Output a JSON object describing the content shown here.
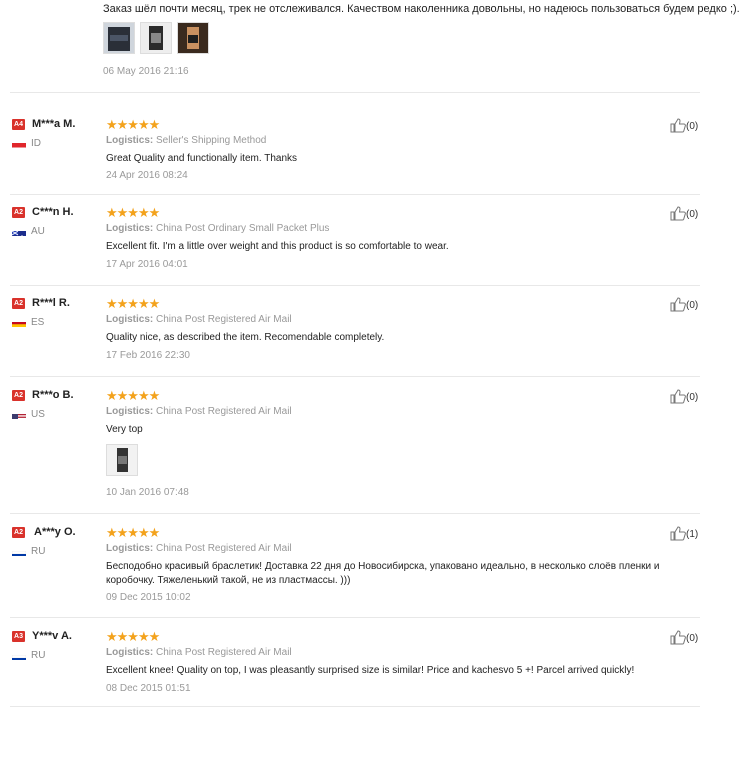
{
  "top": {
    "text": "Заказ шёл почти месяц, трек не отслеживался. Качеством наколенника довольны, но надеюсь пользоваться будем редко ;).",
    "date": "06 May 2016 21:16"
  },
  "logistics_label": "Logistics:",
  "reviews": [
    {
      "badge": "A4",
      "name": "M***a M.",
      "country": "ID",
      "stars": "★★★★★",
      "logistics": "Seller's Shipping Method",
      "text": "Great Quality and functionally item. Thanks",
      "date": "24 Apr 2016 08:24",
      "likes": "(0)"
    },
    {
      "badge": "A2",
      "name": "C***n H.",
      "country": "AU",
      "stars": "★★★★★",
      "logistics": "China Post Ordinary Small Packet Plus",
      "text": "Excellent fit. I'm a little over weight and this product is so comfortable to wear.",
      "date": "17 Apr 2016 04:01",
      "likes": "(0)"
    },
    {
      "badge": "A2",
      "name": "R***l R.",
      "country": "ES",
      "stars": "★★★★★",
      "logistics": "China Post Registered Air Mail",
      "text": "Quality nice, as described the item. Recomendable completely.",
      "date": "17 Feb 2016 22:30",
      "likes": "(0)"
    },
    {
      "badge": "A2",
      "name": "R***o B.",
      "country": "US",
      "stars": "★★★★★",
      "logistics": "China Post Registered Air Mail",
      "text": "Very top",
      "date": "10 Jan 2016 07:48",
      "likes": "(0)"
    },
    {
      "badge": "A2",
      "name": "A***y O.",
      "country": "RU",
      "stars": "★★★★★",
      "logistics": "China Post Registered Air Mail",
      "text": "Бесподобно красивый браслетик! Доставка 22 дня до Новосибирска, упаковано идеально, в несколько слоёв пленки и коробочку. Тяжеленький такой, не из пластмассы. )))",
      "date": "09 Dec 2015 10:02",
      "likes": "(1)"
    },
    {
      "badge": "A3",
      "name": "Y***v A.",
      "country": "RU",
      "stars": "★★★★★",
      "logistics": "China Post Registered Air Mail",
      "text": "Excellent knee! Quality on top, I was pleasantly surprised size is similar! Price and kachesvo 5 +! Parcel arrived quickly!",
      "date": "08 Dec 2015 01:51",
      "likes": "(0)"
    }
  ],
  "colors": {
    "badge": "#d9322b",
    "stars": "#f3a21c",
    "muted": "#999999"
  }
}
